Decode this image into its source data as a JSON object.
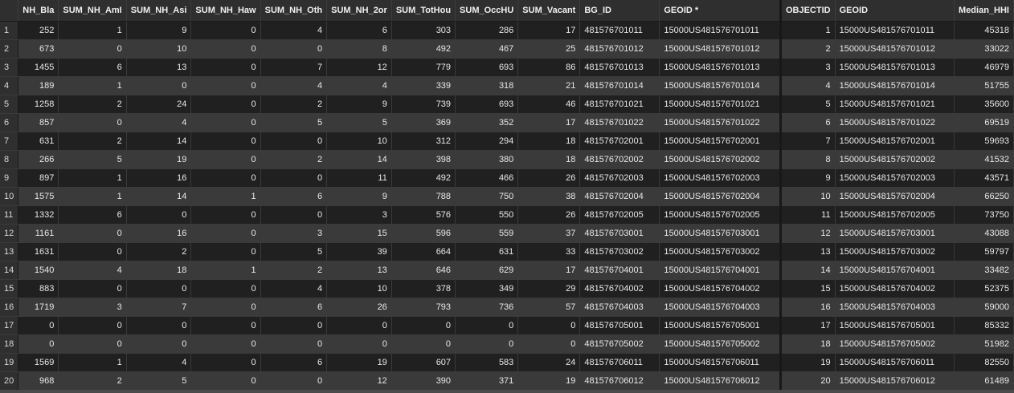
{
  "columns": [
    "",
    "NH_Bla",
    "SUM_NH_AmI",
    "SUM_NH_Asi",
    "SUM_NH_Haw",
    "SUM_NH_Oth",
    "SUM_NH_2or",
    "SUM_TotHou",
    "SUM_OccHU",
    "SUM_Vacant",
    "BG_ID",
    "GEOID *",
    "OBJECTID",
    "GEOID",
    "Median_HHI"
  ],
  "rows": [
    [
      "1",
      "252",
      "1",
      "9",
      "0",
      "4",
      "6",
      "303",
      "286",
      "17",
      "481576701011",
      "15000US481576701011",
      "1",
      "15000US481576701011",
      "45318"
    ],
    [
      "2",
      "673",
      "0",
      "10",
      "0",
      "0",
      "8",
      "492",
      "467",
      "25",
      "481576701012",
      "15000US481576701012",
      "2",
      "15000US481576701012",
      "33022"
    ],
    [
      "3",
      "1455",
      "6",
      "13",
      "0",
      "7",
      "12",
      "779",
      "693",
      "86",
      "481576701013",
      "15000US481576701013",
      "3",
      "15000US481576701013",
      "46979"
    ],
    [
      "4",
      "189",
      "1",
      "0",
      "0",
      "4",
      "4",
      "339",
      "318",
      "21",
      "481576701014",
      "15000US481576701014",
      "4",
      "15000US481576701014",
      "51755"
    ],
    [
      "5",
      "1258",
      "2",
      "24",
      "0",
      "2",
      "9",
      "739",
      "693",
      "46",
      "481576701021",
      "15000US481576701021",
      "5",
      "15000US481576701021",
      "35600"
    ],
    [
      "6",
      "857",
      "0",
      "4",
      "0",
      "5",
      "5",
      "369",
      "352",
      "17",
      "481576701022",
      "15000US481576701022",
      "6",
      "15000US481576701022",
      "69519"
    ],
    [
      "7",
      "631",
      "2",
      "14",
      "0",
      "0",
      "10",
      "312",
      "294",
      "18",
      "481576702001",
      "15000US481576702001",
      "7",
      "15000US481576702001",
      "59693"
    ],
    [
      "8",
      "266",
      "5",
      "19",
      "0",
      "2",
      "14",
      "398",
      "380",
      "18",
      "481576702002",
      "15000US481576702002",
      "8",
      "15000US481576702002",
      "41532"
    ],
    [
      "9",
      "897",
      "1",
      "16",
      "0",
      "0",
      "11",
      "492",
      "466",
      "26",
      "481576702003",
      "15000US481576702003",
      "9",
      "15000US481576702003",
      "43571"
    ],
    [
      "10",
      "1575",
      "1",
      "14",
      "1",
      "6",
      "9",
      "788",
      "750",
      "38",
      "481576702004",
      "15000US481576702004",
      "10",
      "15000US481576702004",
      "66250"
    ],
    [
      "11",
      "1332",
      "6",
      "0",
      "0",
      "0",
      "3",
      "576",
      "550",
      "26",
      "481576702005",
      "15000US481576702005",
      "11",
      "15000US481576702005",
      "73750"
    ],
    [
      "12",
      "1161",
      "0",
      "16",
      "0",
      "3",
      "15",
      "596",
      "559",
      "37",
      "481576703001",
      "15000US481576703001",
      "12",
      "15000US481576703001",
      "43088"
    ],
    [
      "13",
      "1631",
      "0",
      "2",
      "0",
      "5",
      "39",
      "664",
      "631",
      "33",
      "481576703002",
      "15000US481576703002",
      "13",
      "15000US481576703002",
      "59797"
    ],
    [
      "14",
      "1540",
      "4",
      "18",
      "1",
      "2",
      "13",
      "646",
      "629",
      "17",
      "481576704001",
      "15000US481576704001",
      "14",
      "15000US481576704001",
      "33482"
    ],
    [
      "15",
      "883",
      "0",
      "0",
      "0",
      "4",
      "10",
      "378",
      "349",
      "29",
      "481576704002",
      "15000US481576704002",
      "15",
      "15000US481576704002",
      "52375"
    ],
    [
      "16",
      "1719",
      "3",
      "7",
      "0",
      "6",
      "26",
      "793",
      "736",
      "57",
      "481576704003",
      "15000US481576704003",
      "16",
      "15000US481576704003",
      "59000"
    ],
    [
      "17",
      "0",
      "0",
      "0",
      "0",
      "0",
      "0",
      "0",
      "0",
      "0",
      "481576705001",
      "15000US481576705001",
      "17",
      "15000US481576705001",
      "85332"
    ],
    [
      "18",
      "0",
      "0",
      "0",
      "0",
      "0",
      "0",
      "0",
      "0",
      "0",
      "481576705002",
      "15000US481576705002",
      "18",
      "15000US481576705002",
      "51982"
    ],
    [
      "19",
      "1569",
      "1",
      "4",
      "0",
      "6",
      "19",
      "607",
      "583",
      "24",
      "481576706011",
      "15000US481576706011",
      "19",
      "15000US481576706011",
      "82550"
    ],
    [
      "20",
      "968",
      "2",
      "5",
      "0",
      "0",
      "12",
      "390",
      "371",
      "19",
      "481576706012",
      "15000US481576706012",
      "20",
      "15000US481576706012",
      "61489"
    ]
  ]
}
